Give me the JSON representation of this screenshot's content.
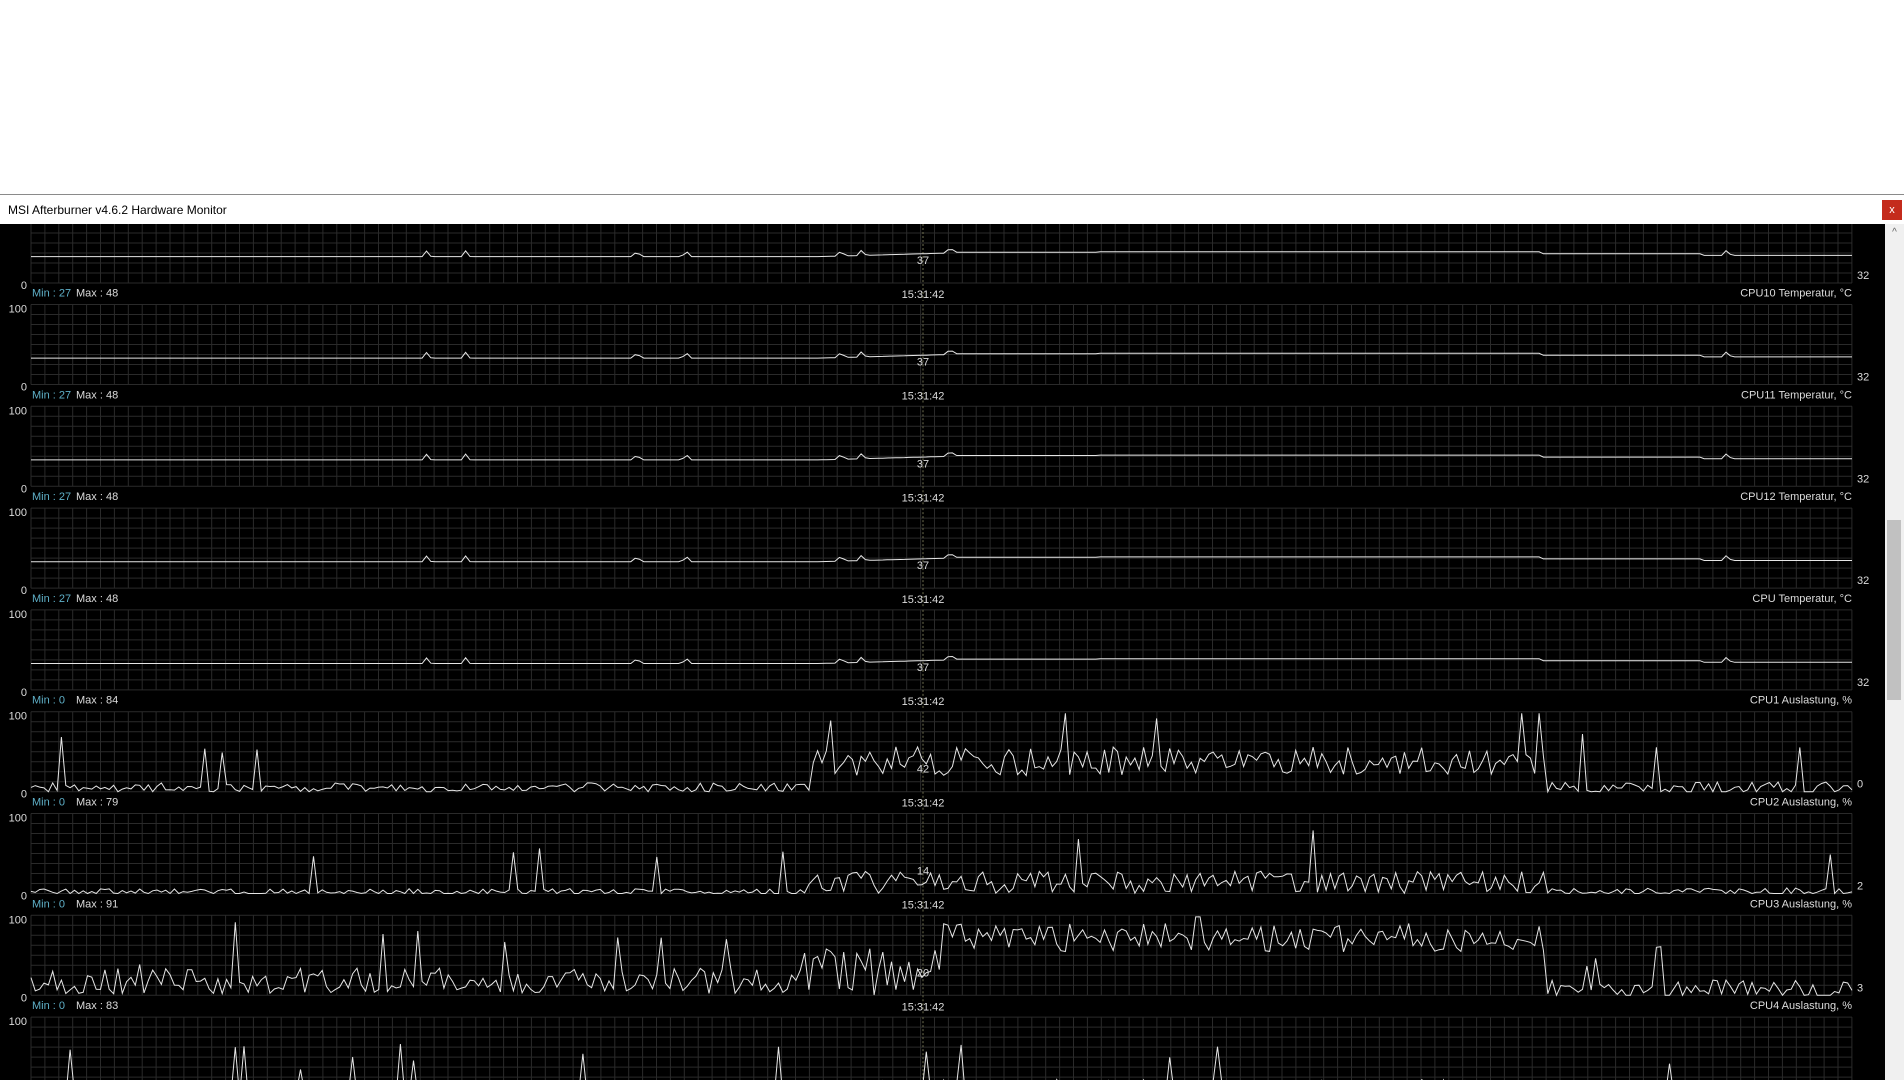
{
  "window": {
    "title": "MSI Afterburner v4.6.2 Hardware Monitor",
    "close_label": "x"
  },
  "scrollbar": {
    "up_arrow": "^"
  },
  "cursor_time": "15:31:42",
  "colors": {
    "background": "#000000",
    "grid": "#2a2a2a",
    "line": "#e6e6e6",
    "min_label": "#5fb0c8",
    "text": "#dcdcdc"
  },
  "graphs": [
    {
      "name": "",
      "min": "",
      "max": "",
      "y_top": "",
      "y_bottom": "0",
      "cursor_value": "37",
      "current_value": "32",
      "time_label": "15:31:42",
      "kind": "temp",
      "partial": "top"
    },
    {
      "name": "CPU10 Temperatur, °C",
      "min": "Min : 27",
      "max": "Max : 48",
      "y_top": "100",
      "y_bottom": "0",
      "cursor_value": "37",
      "current_value": "32",
      "time_label": "15:31:42",
      "kind": "temp"
    },
    {
      "name": "CPU11 Temperatur, °C",
      "min": "Min : 27",
      "max": "Max : 48",
      "y_top": "100",
      "y_bottom": "0",
      "cursor_value": "37",
      "current_value": "32",
      "time_label": "15:31:42",
      "kind": "temp"
    },
    {
      "name": "CPU12 Temperatur, °C",
      "min": "Min : 27",
      "max": "Max : 48",
      "y_top": "100",
      "y_bottom": "0",
      "cursor_value": "37",
      "current_value": "32",
      "time_label": "15:31:42",
      "kind": "temp"
    },
    {
      "name": "CPU Temperatur, °C",
      "min": "Min : 27",
      "max": "Max : 48",
      "y_top": "100",
      "y_bottom": "0",
      "cursor_value": "37",
      "current_value": "32",
      "time_label": "15:31:42",
      "kind": "temp"
    },
    {
      "name": "CPU1 Auslastung, %",
      "min": "Min : 0",
      "max": "Max : 84",
      "y_top": "100",
      "y_bottom": "0",
      "cursor_value": "42",
      "current_value": "0",
      "time_label": "15:31:42",
      "kind": "load1"
    },
    {
      "name": "CPU2 Auslastung, %",
      "min": "Min : 0",
      "max": "Max : 79",
      "y_top": "100",
      "y_bottom": "0",
      "cursor_value": "14",
      "current_value": "2",
      "time_label": "15:31:42",
      "kind": "load2"
    },
    {
      "name": "CPU3 Auslastung, %",
      "min": "Min : 0",
      "max": "Max : 91",
      "y_top": "100",
      "y_bottom": "0",
      "cursor_value": "20",
      "current_value": "3",
      "time_label": "15:31:42",
      "kind": "load3"
    },
    {
      "name": "CPU4 Auslastung, %",
      "min": "Min : 0",
      "max": "Max : 83",
      "y_top": "100",
      "y_bottom": "",
      "cursor_value": "",
      "current_value": "",
      "time_label": "",
      "kind": "load4",
      "partial": "bottom"
    }
  ]
}
